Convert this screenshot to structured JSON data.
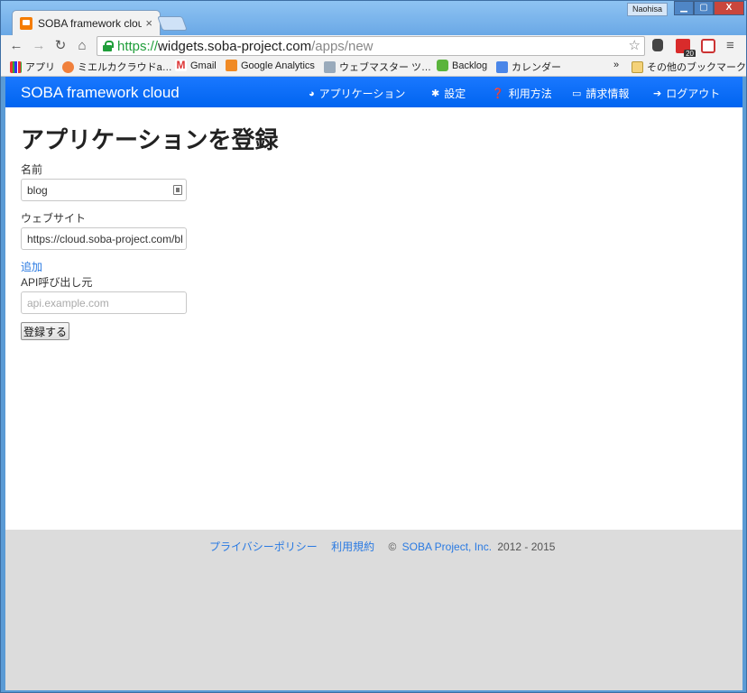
{
  "browser": {
    "tab_title": "SOBA framework cloud",
    "tab_close": "×",
    "user": "Naohisa",
    "url_scheme": "https://",
    "url_host": "widgets.soba-project.com",
    "url_path": "/apps/new",
    "bookmarks": [
      {
        "label": "アプリ"
      },
      {
        "label": "ミエルカクラウド​a…"
      },
      {
        "label": "Gmail"
      },
      {
        "label": "Google Analytics"
      },
      {
        "label": "ウェブマスター ツ…"
      },
      {
        "label": "Backlog"
      },
      {
        "label": "カレンダー"
      }
    ],
    "bookmarks_more": "»",
    "other_bookmarks": "その他のブックマーク",
    "extension_badge": "20"
  },
  "navbar": {
    "brand": "SOBA framework cloud",
    "items": [
      {
        "label": "アプリケーション",
        "icon": "globe-icon"
      },
      {
        "label": "設定",
        "icon": "gear-icon"
      },
      {
        "label": "利用方法",
        "icon": "question-icon"
      },
      {
        "label": "請求情報",
        "icon": "credit-card-icon"
      },
      {
        "label": "ログアウト",
        "icon": "arrow-right-icon"
      }
    ]
  },
  "form": {
    "title": "アプリケーションを登録",
    "name_label": "名前",
    "name_value": "blog",
    "website_label": "ウェブサイト",
    "website_value": "https://cloud.soba-project.com/bl",
    "add_link": "追加",
    "api_label": "API呼び出し元",
    "api_placeholder": "api.example.com",
    "submit": "登録する"
  },
  "footer": {
    "privacy": "プライバシーポリシー",
    "terms": "利用規約",
    "copyright_prefix": "©",
    "org": "SOBA Project, Inc.",
    "years": "2012 - 2015"
  },
  "colors": {
    "navbar": "#0a6dfa",
    "link": "#2a7ae2",
    "footer_bg": "#dcdcdc"
  }
}
